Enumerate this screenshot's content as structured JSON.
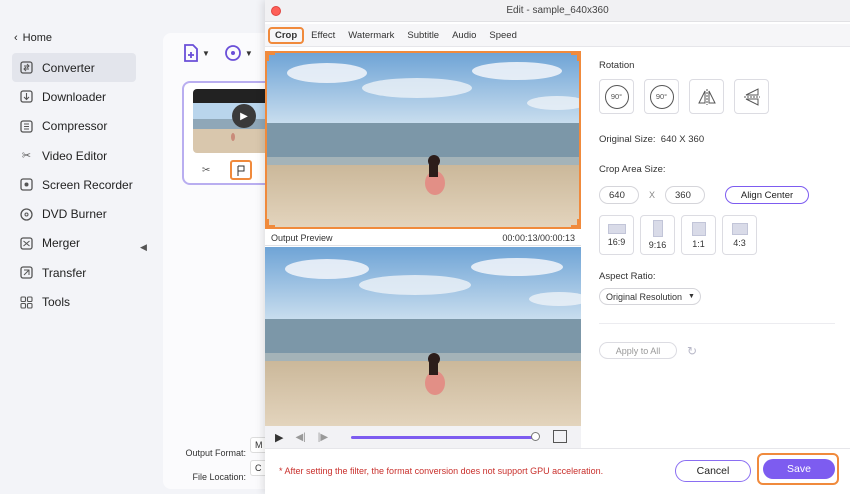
{
  "sidebar": {
    "home_label": "Home",
    "items": [
      {
        "label": "Converter",
        "icon": "converter-icon"
      },
      {
        "label": "Downloader",
        "icon": "downloader-icon"
      },
      {
        "label": "Compressor",
        "icon": "compressor-icon"
      },
      {
        "label": "Video Editor",
        "icon": "scissors-icon"
      },
      {
        "label": "Screen Recorder",
        "icon": "screen-recorder-icon"
      },
      {
        "label": "DVD Burner",
        "icon": "disc-icon"
      },
      {
        "label": "Merger",
        "icon": "merger-icon"
      },
      {
        "label": "Transfer",
        "icon": "transfer-icon"
      },
      {
        "label": "Tools",
        "icon": "grid-icon"
      }
    ]
  },
  "background": {
    "output_format_label": "Output Format:",
    "output_format_value": "M",
    "file_location_label": "File Location:",
    "file_location_value": "C"
  },
  "dialog": {
    "title": "Edit - sample_640x360",
    "tabs": [
      "Crop",
      "Effect",
      "Watermark",
      "Subtitle",
      "Audio",
      "Speed"
    ],
    "active_tab": "Crop",
    "output_preview_label": "Output Preview",
    "timecode": "00:00:13/00:00:13",
    "rotation_label": "Rotation",
    "rotation_buttons": [
      {
        "label": "90°",
        "name": "rotate-left"
      },
      {
        "label": "90°",
        "name": "rotate-right"
      },
      {
        "label": "",
        "name": "flip-horizontal"
      },
      {
        "label": "",
        "name": "flip-vertical"
      }
    ],
    "original_size_label": "Original Size:",
    "original_size_value": "640 X 360",
    "crop_area_label": "Crop Area Size:",
    "crop_width": "640",
    "crop_x_sep": "X",
    "crop_height": "360",
    "align_center_label": "Align Center",
    "ratios": [
      "16:9",
      "9:16",
      "1:1",
      "4:3"
    ],
    "aspect_ratio_label": "Aspect Ratio:",
    "aspect_ratio_value": "Original Resolution",
    "apply_all_label": "Apply to All",
    "warning": "* After setting the filter, the format conversion does not support GPU acceleration.",
    "cancel_label": "Cancel",
    "save_label": "Save"
  },
  "colors": {
    "accent": "#7d5cf0",
    "highlight": "#f08a3c",
    "warning": "#c9302c"
  }
}
